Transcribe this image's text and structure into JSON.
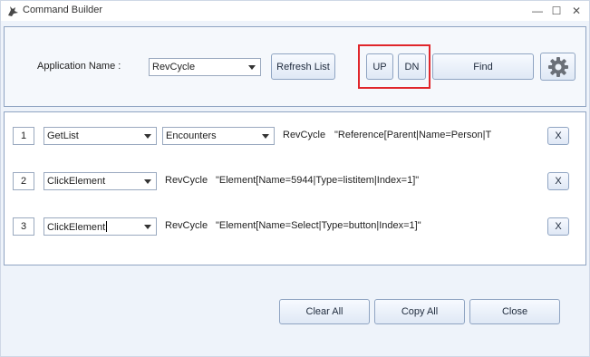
{
  "window": {
    "title": "Command Builder",
    "minimize": "—",
    "maximize": "☐",
    "close": "✕"
  },
  "header": {
    "app_label": "Application Name :",
    "app_value": "RevCycle",
    "refresh_label": "Refresh List",
    "up_label": "UP",
    "dn_label": "DN",
    "find_label": "Find"
  },
  "commands": [
    {
      "index": "1",
      "action": "GetList",
      "target": "Encounters",
      "app": "RevCycle",
      "locator": "\"Reference[Parent|Name=Person|T"
    },
    {
      "index": "2",
      "action": "ClickElement",
      "app": "RevCycle",
      "locator": "\"Element[Name=5944|Type=listitem|Index=1]\""
    },
    {
      "index": "3",
      "action": "ClickElement",
      "app": "RevCycle",
      "locator": "\"Element[Name=Select|Type=button|Index=1]\""
    }
  ],
  "remove_label": "X",
  "footer": {
    "clear_label": "Clear All",
    "copy_label": "Copy All",
    "close_label": "Close"
  },
  "colors": {
    "highlight": "#e0262b",
    "panel_border": "#8fa4c2",
    "background": "#eef3fa"
  }
}
